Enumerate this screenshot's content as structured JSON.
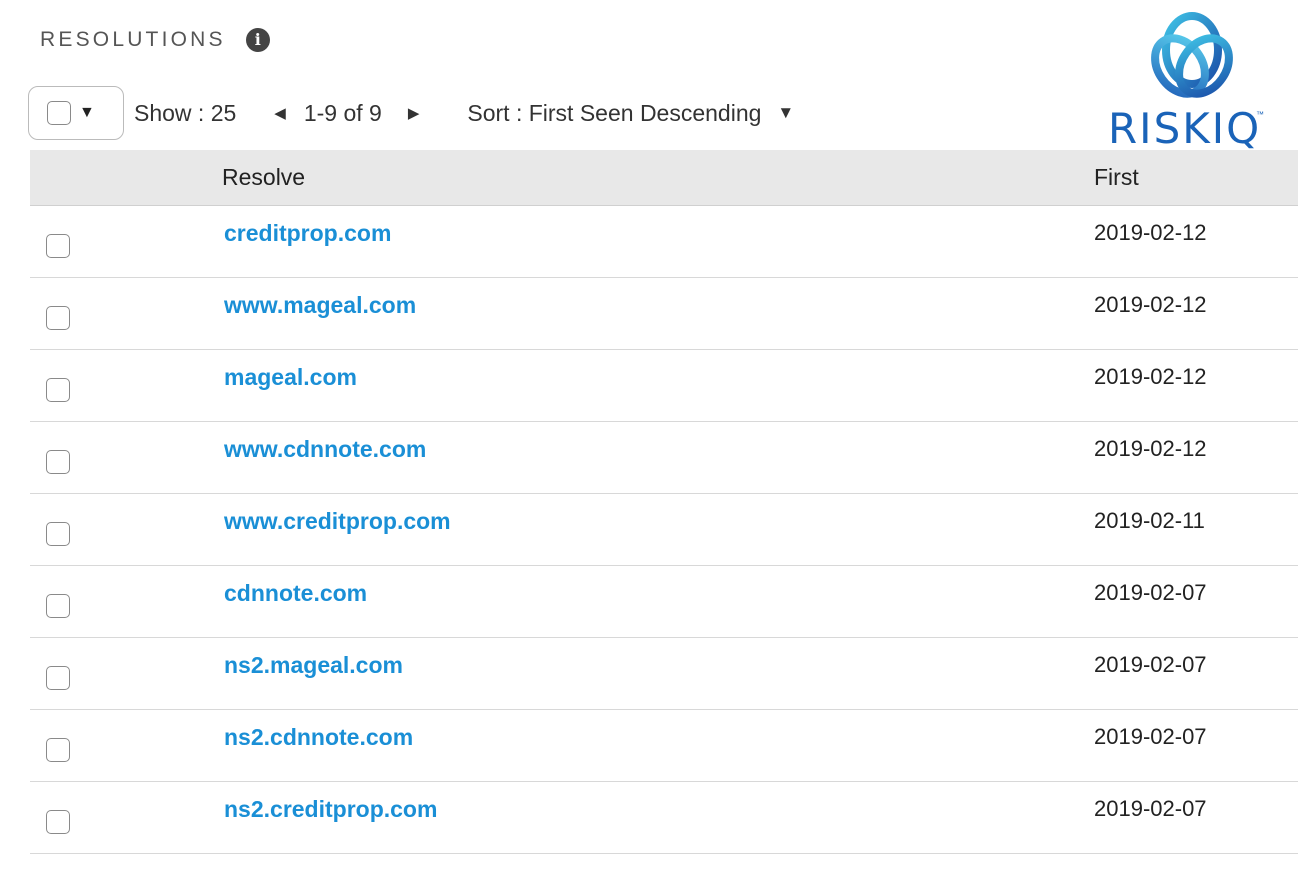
{
  "panel": {
    "title": "RESOLUTIONS",
    "info_icon": "info-circle-icon"
  },
  "toolbar": {
    "show_label": "Show : 25",
    "prev_icon": "◀",
    "range_label": "1-9 of 9",
    "next_icon": "▶",
    "sort_label": "Sort : First Seen Descending",
    "dropdown_icon": "▼"
  },
  "logo": {
    "text": "RISKIQ",
    "tm": "™",
    "color": "#1a63b8"
  },
  "table": {
    "columns": [
      "Resolve",
      "First"
    ],
    "rows": [
      {
        "resolve": "creditprop.com",
        "first": "2019-02-12"
      },
      {
        "resolve": "www.mageal.com",
        "first": "2019-02-12"
      },
      {
        "resolve": "mageal.com",
        "first": "2019-02-12"
      },
      {
        "resolve": "www.cdnnote.com",
        "first": "2019-02-12"
      },
      {
        "resolve": "www.creditprop.com",
        "first": "2019-02-11"
      },
      {
        "resolve": "cdnnote.com",
        "first": "2019-02-07"
      },
      {
        "resolve": "ns2.mageal.com",
        "first": "2019-02-07"
      },
      {
        "resolve": "ns2.cdnnote.com",
        "first": "2019-02-07"
      },
      {
        "resolve": "ns2.creditprop.com",
        "first": "2019-02-07"
      }
    ]
  },
  "colors": {
    "link": "#1a8fd6",
    "header_bg": "#e8e8e8"
  }
}
